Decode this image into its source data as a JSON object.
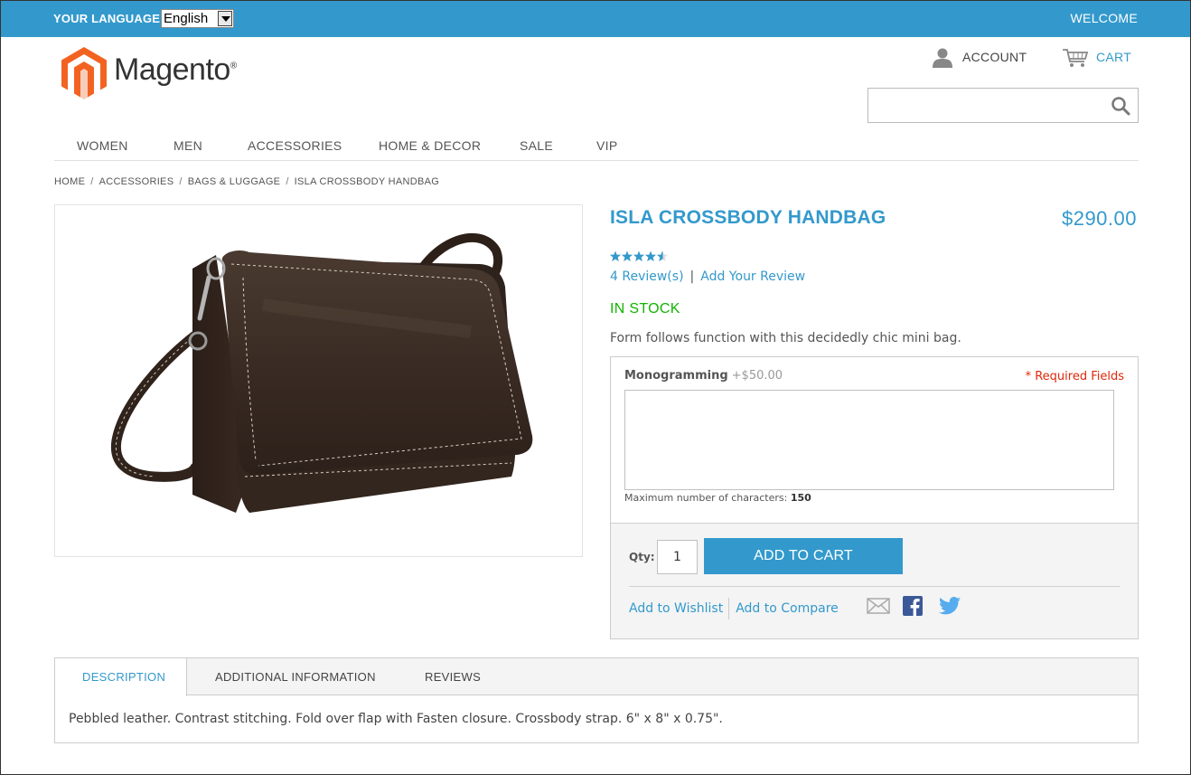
{
  "topbar": {
    "language_label": "YOUR LANGUAGE:",
    "language_selected": "English",
    "welcome": "WELCOME",
    "bg_color": "#3399cc"
  },
  "header": {
    "logo_text": "Magento",
    "logo_reg": "®",
    "account_label": "ACCOUNT",
    "cart_label": "CART",
    "search_placeholder": ""
  },
  "nav": {
    "items": [
      "WOMEN",
      "MEN",
      "ACCESSORIES",
      "HOME & DECOR",
      "SALE",
      "VIP"
    ]
  },
  "breadcrumb": {
    "items": [
      "HOME",
      "ACCESSORIES",
      "BAGS & LUGGAGE",
      "ISLA CROSSBODY HANDBAG"
    ],
    "separator": "/"
  },
  "product": {
    "name": "ISLA CROSSBODY HANDBAG",
    "price": "$290.00",
    "rating_fraction": 0.9,
    "reviews_link": "4 Review(s)",
    "reviews_separator": "|",
    "add_review_link": "Add Your Review",
    "stock": "IN STOCK",
    "short_description": "Form follows function with this decidedly chic mini bag."
  },
  "options": {
    "label": "Monogramming",
    "extra_price": "+$50.00",
    "required_text": "* Required Fields",
    "max_chars_label": "Maximum number of characters:",
    "max_chars_value": "150"
  },
  "add_to_cart": {
    "qty_label": "Qty:",
    "qty_value": "1",
    "button_label": "ADD TO CART",
    "wishlist_link": "Add to Wishlist",
    "compare_link": "Add to Compare"
  },
  "tabs": {
    "items": [
      "DESCRIPTION",
      "ADDITIONAL INFORMATION",
      "REVIEWS"
    ],
    "active": "DESCRIPTION",
    "content": "Pebbled leather. Contrast stitching. Fold over flap with Fasten closure. Crossbody strap. 6\" x 8\" x 0.75\"."
  },
  "colors": {
    "accent": "#3399cc",
    "in_stock": "#11b400",
    "required": "#df280a",
    "logo_orange": "#f26322"
  }
}
